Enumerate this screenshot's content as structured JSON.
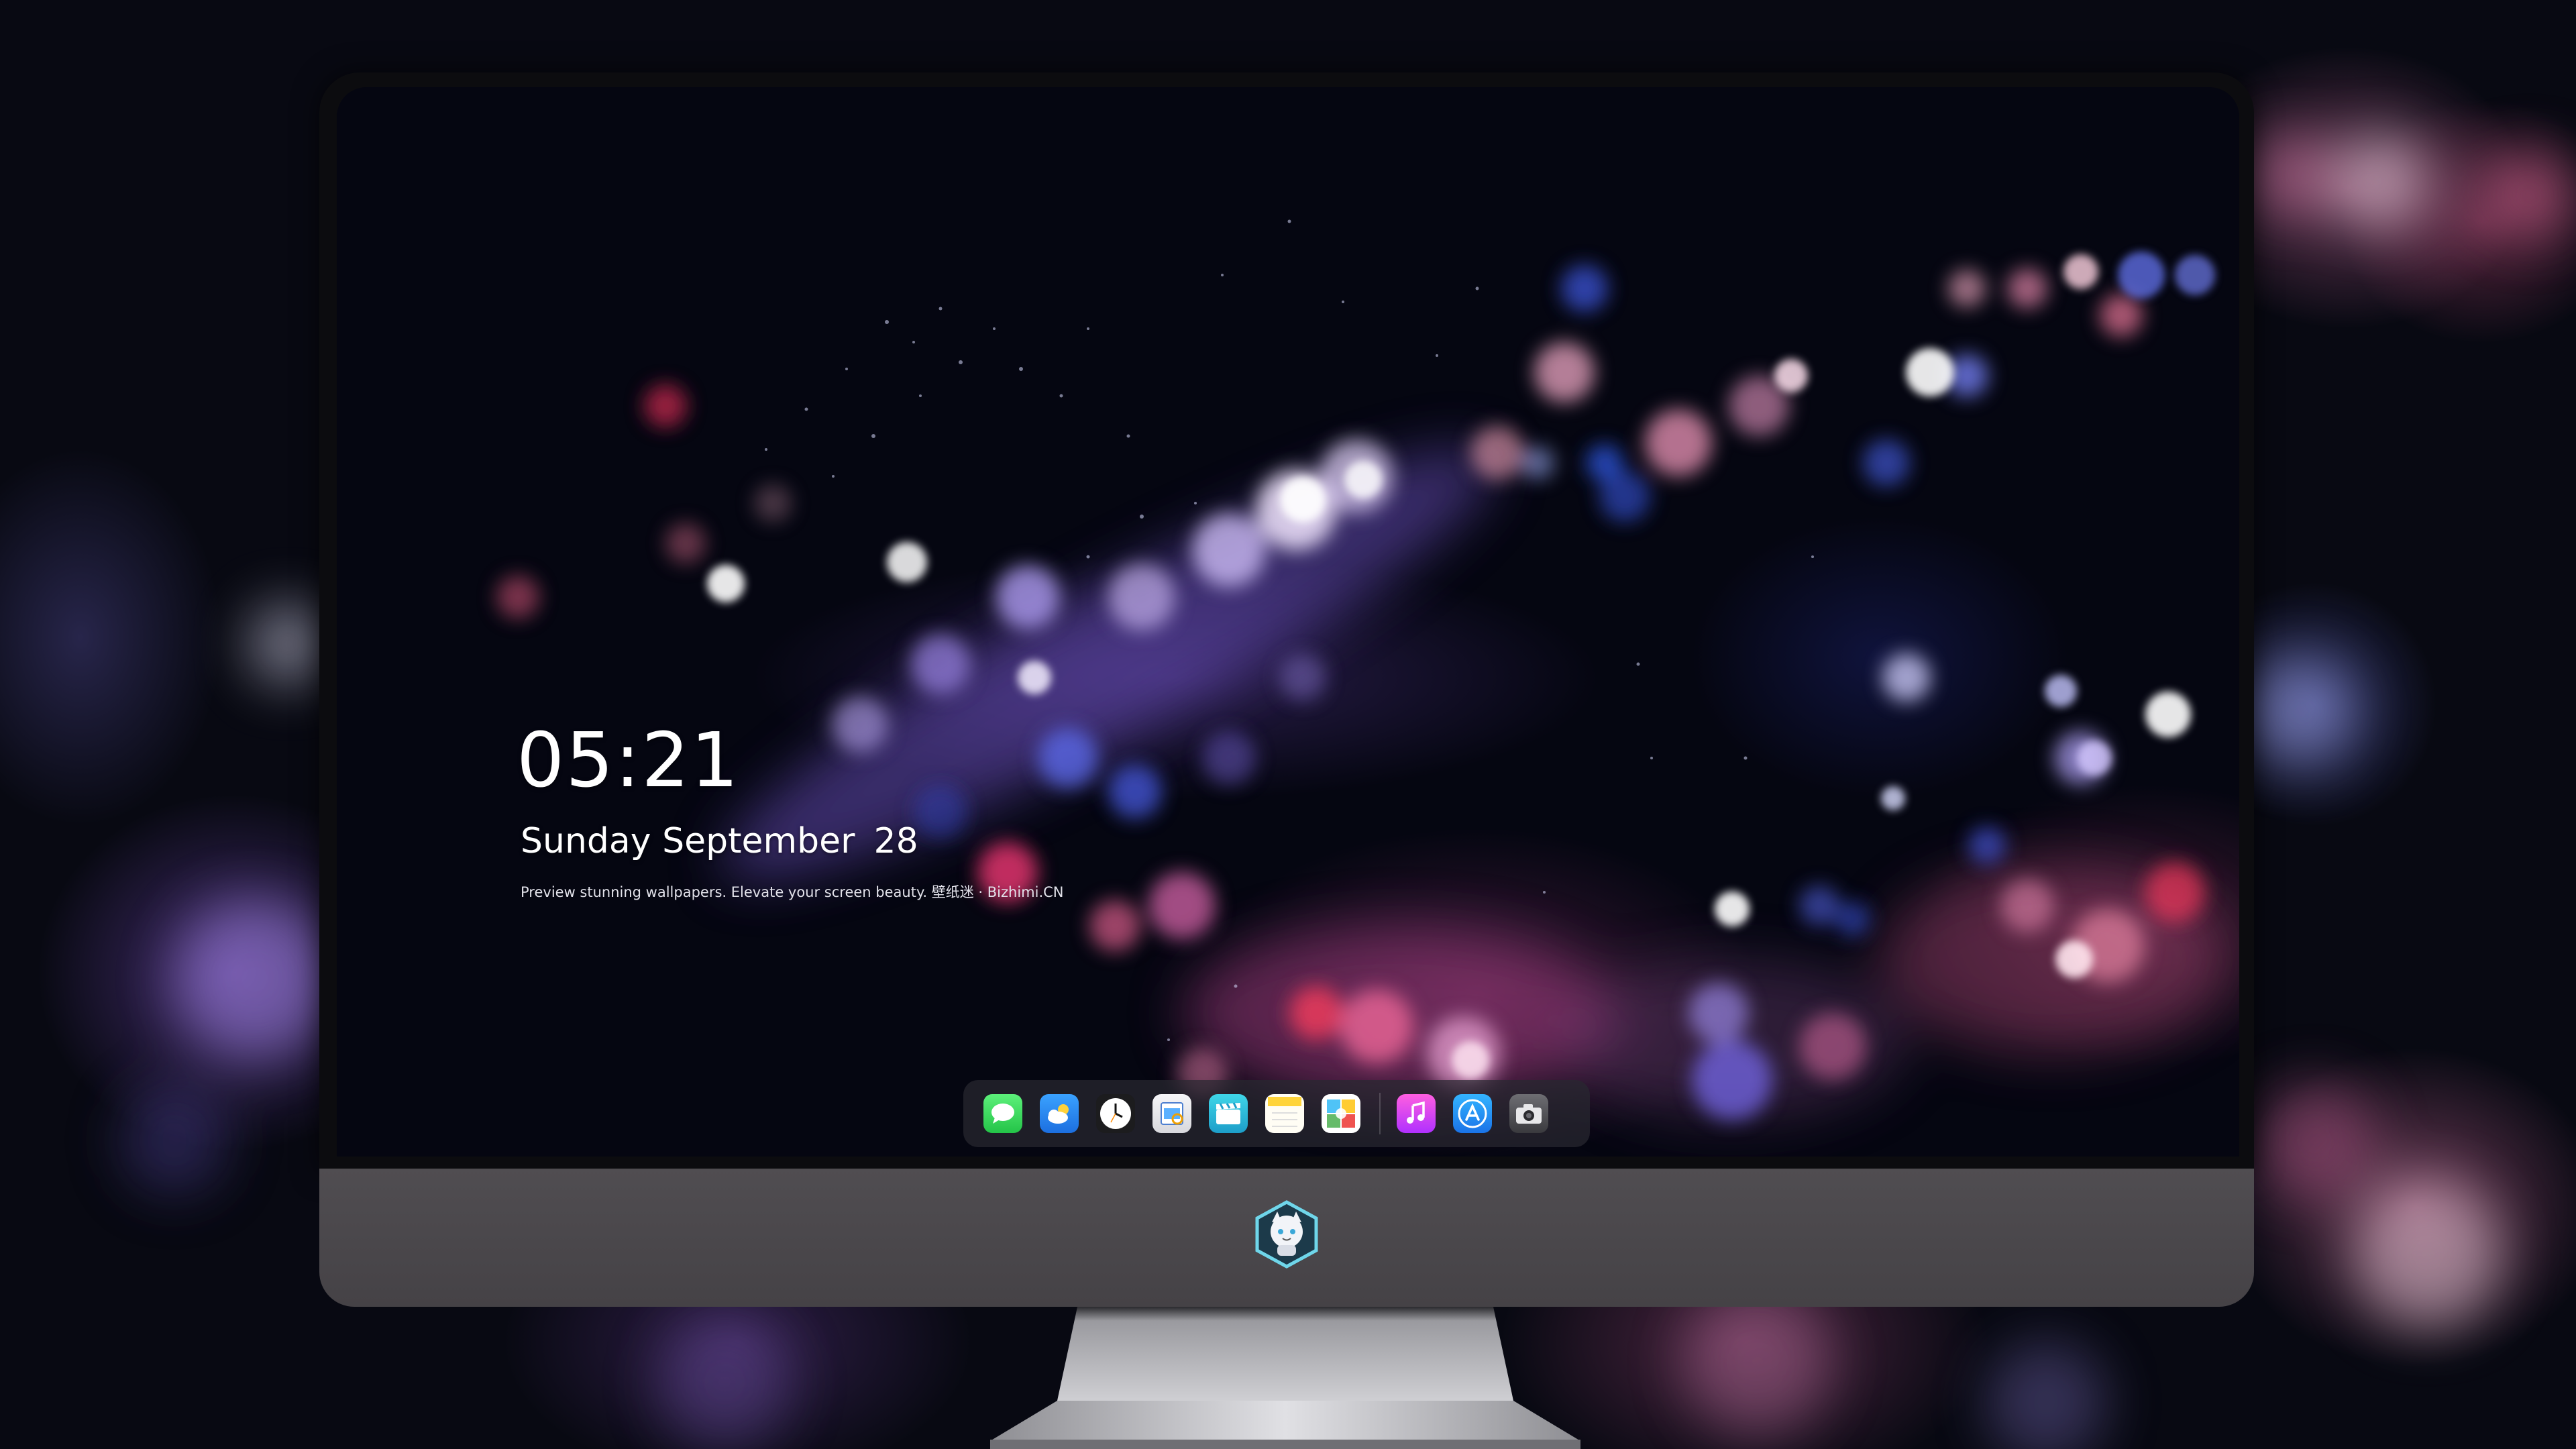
{
  "lock_screen": {
    "time": "05:21",
    "weekday_month": "Sunday September",
    "day": "28",
    "tagline": "Preview stunning wallpapers. Elevate your screen beauty. 壁纸迷 · Bizhimi.CN"
  },
  "dock": {
    "apps": [
      {
        "icon": "messages-icon"
      },
      {
        "icon": "weather-icon"
      },
      {
        "icon": "clock-icon"
      },
      {
        "icon": "preview-icon"
      },
      {
        "icon": "clips-icon"
      },
      {
        "icon": "notes-icon"
      },
      {
        "icon": "photo-booth-icon"
      },
      {
        "icon": "music-icon"
      },
      {
        "icon": "app-store-icon"
      },
      {
        "icon": "camera-icon"
      }
    ]
  },
  "monitor": {
    "logo": "mascot-badge-icon",
    "accent_colors": {
      "bezel": "#0c0c0f",
      "chin": "#4b484c",
      "stand": "#cfcfd2"
    }
  }
}
